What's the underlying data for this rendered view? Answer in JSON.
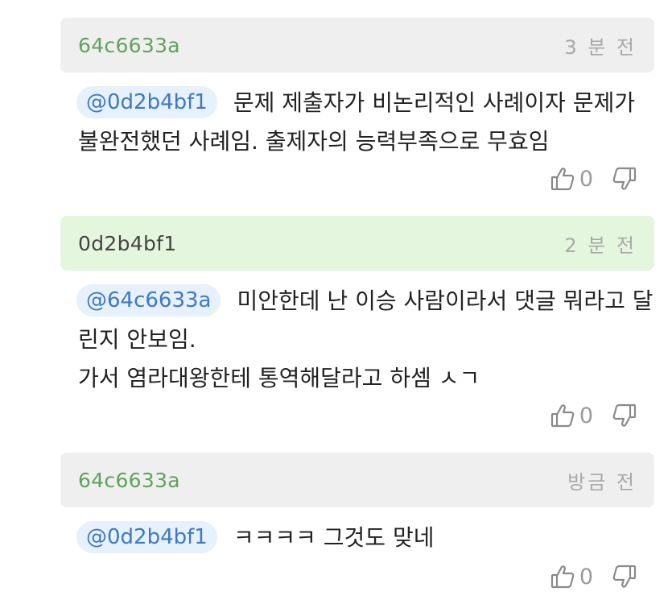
{
  "comments": [
    {
      "author": "64c6633a",
      "time": "3 분 전",
      "mention": "@0d2b4bf1",
      "text": "문제 제출자가 비논리적인 사례이자 문제가 불완전했던 사례임. 출제자의 능력부족으로 무효임",
      "likes": "0",
      "header_style": "gray",
      "author_color": "#5fa35a"
    },
    {
      "author": "0d2b4bf1",
      "time": "2 분 전",
      "mention": "@64c6633a",
      "text": "미안한데 난 이승 사람이라서 댓글 뭐라고 달린지 안보임.\n가서 염라대왕한테 통역해달라고 하셈 ㅅㄱ",
      "likes": "0",
      "header_style": "green",
      "author_color": "#444444"
    },
    {
      "author": "64c6633a",
      "time": "방금 전",
      "mention": "@0d2b4bf1",
      "text": "ㅋㅋㅋㅋ 그것도 맞네",
      "likes": "0",
      "header_style": "gray",
      "author_color": "#5fa35a"
    }
  ],
  "icons": {
    "like": "thumbs-up-icon",
    "dislike": "thumbs-down-icon"
  }
}
